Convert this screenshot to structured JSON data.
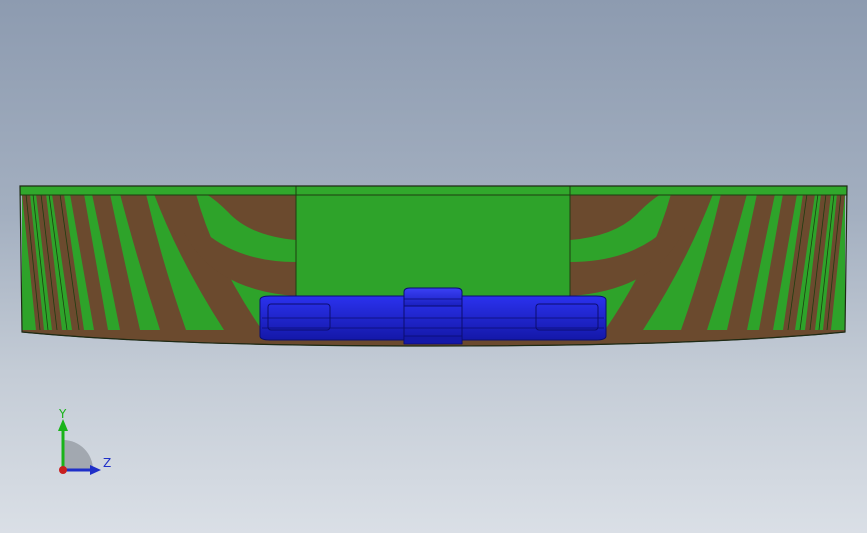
{
  "viewport": {
    "background_top": "#8d9bb0",
    "background_bottom": "#dadfe6"
  },
  "model": {
    "part_body_color": "#2ea32a",
    "part_dark_band_color": "#6b4a2e",
    "insert_color": "#1f23d6",
    "insert_dark_color": "#1215a0"
  },
  "triad": {
    "y_label": "Y",
    "z_label": "Z",
    "y_color": "#19b319",
    "z_color": "#1f2fc8",
    "x_color": "#c81f1f"
  }
}
